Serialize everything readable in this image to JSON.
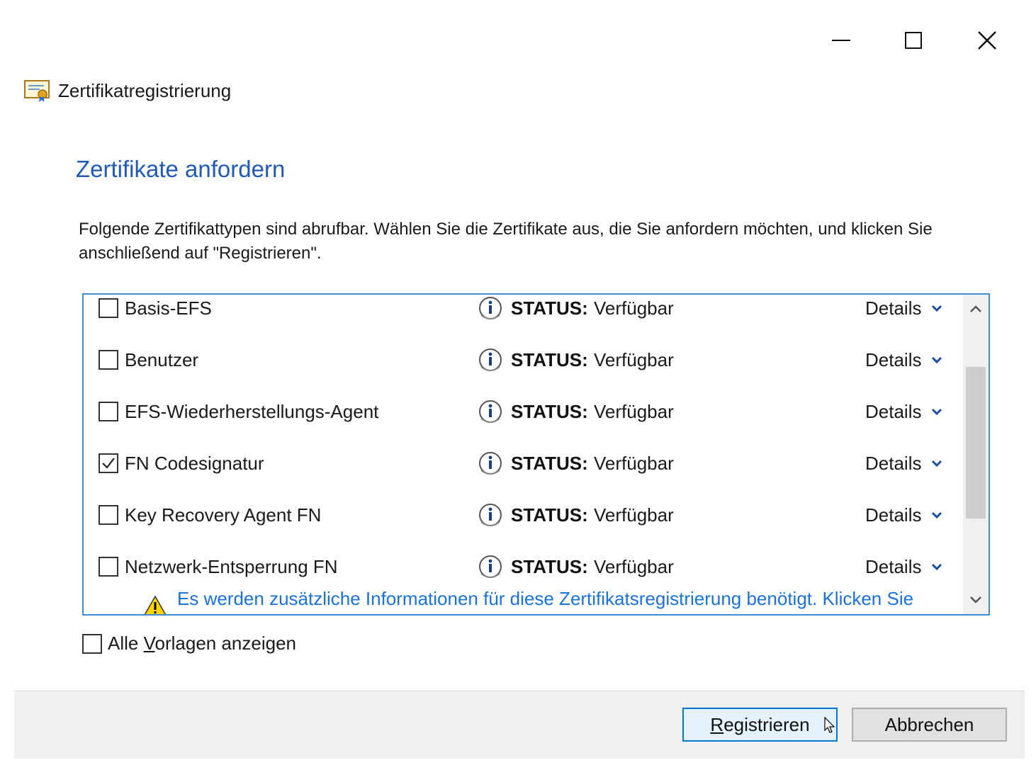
{
  "window": {
    "title": "Zertifikatregistrierung",
    "icon": "certificate-icon"
  },
  "heading": "Zertifikate anfordern",
  "description": "Folgende Zertifikattypen sind abrufbar. Wählen Sie die Zertifikate aus, die Sie anfordern möchten, und klicken Sie anschließend auf \"Registrieren\".",
  "certificates": [
    {
      "name": "Basis-EFS",
      "checked": false,
      "status_label": "STATUS:",
      "status_value": "Verfügbar",
      "details_label": "Details"
    },
    {
      "name": "Benutzer",
      "checked": false,
      "status_label": "STATUS:",
      "status_value": "Verfügbar",
      "details_label": "Details"
    },
    {
      "name": "EFS-Wiederherstellungs-Agent",
      "checked": false,
      "status_label": "STATUS:",
      "status_value": "Verfügbar",
      "details_label": "Details"
    },
    {
      "name": "FN Codesignatur",
      "checked": true,
      "status_label": "STATUS:",
      "status_value": "Verfügbar",
      "details_label": "Details"
    },
    {
      "name": "Key Recovery Agent FN",
      "checked": false,
      "status_label": "STATUS:",
      "status_value": "Verfügbar",
      "details_label": "Details"
    },
    {
      "name": "Netzwerk-Entsperrung FN",
      "checked": false,
      "status_label": "STATUS:",
      "status_value": "Verfügbar",
      "details_label": "Details"
    }
  ],
  "warning_text": "Es werden zusätzliche Informationen für diese Zertifikatsregistrierung benötigt. Klicken Sie",
  "show_all": {
    "label_pre": "Alle ",
    "label_mnemonic": "V",
    "label_post": "orlagen anzeigen",
    "checked": false
  },
  "buttons": {
    "register_mnemonic": "R",
    "register_rest": "egistrieren",
    "cancel": "Abbrechen"
  },
  "colors": {
    "accent": "#1f5bb5",
    "link": "#1a73d8",
    "list_border": "#3d8fd7"
  }
}
